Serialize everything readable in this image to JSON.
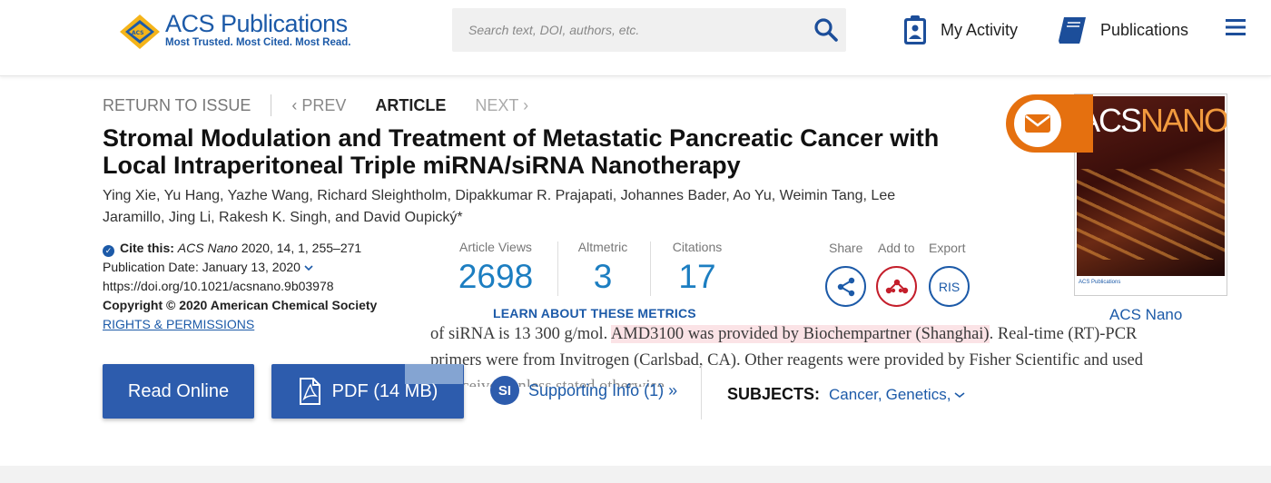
{
  "header": {
    "logo_title": "ACS Publications",
    "logo_tagline": "Most Trusted. Most Cited. Most Read.",
    "search_placeholder": "Search text, DOI, authors, etc.",
    "my_activity": "My Activity",
    "publications": "Publications"
  },
  "article_nav": {
    "return": "RETURN TO ISSUE",
    "prev": "‹ PREV",
    "current": "ARTICLE",
    "next": "NEXT ›"
  },
  "article": {
    "title": "Stromal Modulation and Treatment of Metastatic Pancreatic Cancer with Local Intraperitoneal Triple miRNA/siRNA Nanotherapy",
    "authors": "Ying Xie, Yu Hang, Yazhe Wang, Richard Sleightholm, Dipakkumar R. Prajapati, Johannes Bader, Ao Yu, Weimin Tang, Lee Jaramillo, Jing Li, Rakesh K. Singh, and David Oupický*"
  },
  "cite": {
    "label": "Cite this:",
    "journal": "ACS Nano",
    "ref": "2020, 14, 1, 255–271",
    "pub_date": "Publication Date: January 13, 2020",
    "doi": "https://doi.org/10.1021/acsnano.9b03978",
    "copyright": "Copyright © 2020 American Chemical Society",
    "rights": "RIGHTS & PERMISSIONS"
  },
  "metrics": {
    "views_label": "Article Views",
    "views": "2698",
    "altmetric_label": "Altmetric",
    "altmetric": "3",
    "citations_label": "Citations",
    "citations": "17",
    "learn": "LEARN ABOUT THESE METRICS"
  },
  "share": {
    "share": "Share",
    "add_to": "Add to",
    "export": "Export",
    "ris": "RIS"
  },
  "cover": {
    "journal_a": "ACS",
    "journal_b": "NANO",
    "label": "ACS Nano",
    "publisher": "ACS Publications"
  },
  "overlay": {
    "pre": "of siRNA is 13 300 g/mol. ",
    "highlight": "AMD3100 was provided by Biochempartner (Shanghai)",
    "post": ". Real-time (RT)-PCR",
    "line2": "primers were from Invitrogen (Carlsbad, CA). Other reagents were provided by Fisher Scientific and used",
    "line3": "as received unless stated otherwise."
  },
  "actions": {
    "read_online": "Read Online",
    "pdf": "PDF (14 MB)",
    "si_badge": "SI",
    "supporting_info": "Supporting Info (1) »",
    "subjects_label": "SUBJECTS:",
    "subject_1": "Cancer,",
    "subject_2": "Genetics,"
  },
  "colors": {
    "brand_blue": "#1c5aa8",
    "button_blue": "#2d5cad",
    "metric_blue": "#1c7ec1",
    "mail_orange": "#e5700f",
    "mendeley_red": "#c41e2b"
  },
  "icons": [
    "search-icon",
    "clipboard-user-icon",
    "book-icon",
    "hamburger-icon",
    "check-badge-icon",
    "chevron-down-icon",
    "share-icon",
    "mendeley-icon",
    "mail-icon",
    "pdf-icon"
  ]
}
